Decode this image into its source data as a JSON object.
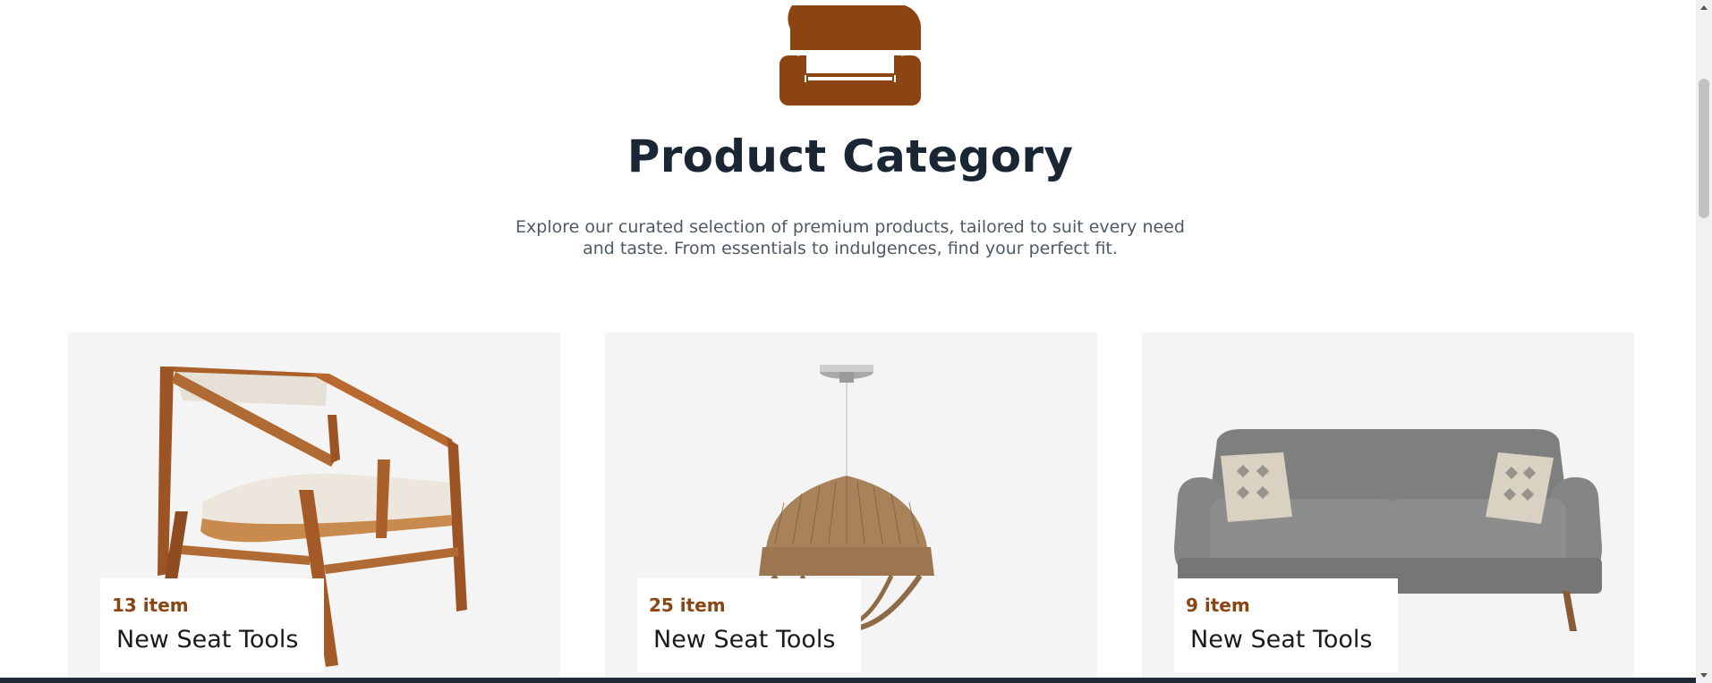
{
  "header": {
    "icon": "sofa-icon",
    "title": "Product Category",
    "subtitle_line1": "Explore our curated selection of premium products, tailored to suit every need",
    "subtitle_line2": "and taste. From essentials to indulgences, find your perfect fit."
  },
  "categories": [
    {
      "count": "13 item",
      "name": "New Seat Tools",
      "image": "wooden-armchair-image"
    },
    {
      "count": "25 item",
      "name": "New Seat Tools",
      "image": "rope-pendant-lamp-image"
    },
    {
      "count": "9 item",
      "name": "New Seat Tools",
      "image": "grey-sofa-image"
    }
  ],
  "colors": {
    "accent": "#8b4513",
    "title": "#1b2634",
    "text_muted": "#4e5a66",
    "card_bg": "#f4f4f4",
    "footer_bar": "#1f2a36"
  }
}
